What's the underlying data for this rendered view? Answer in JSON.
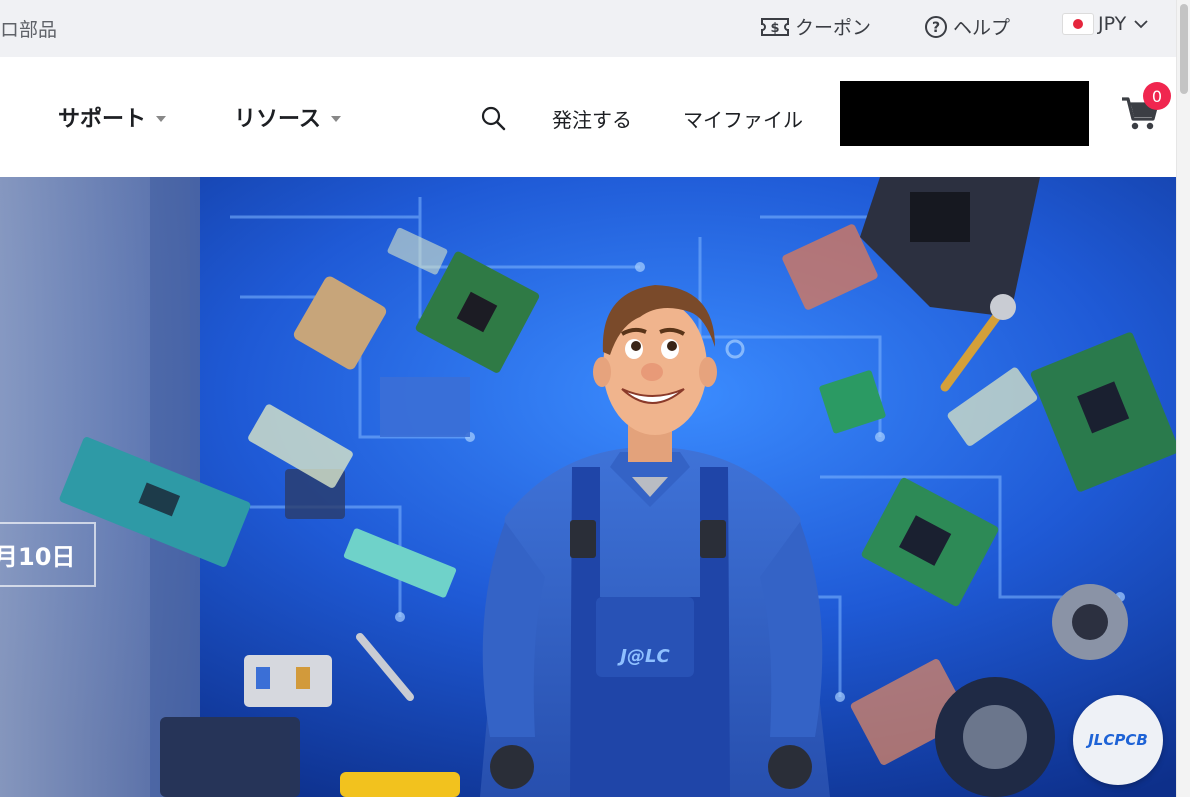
{
  "topbar": {
    "left_text": "ロ部品",
    "coupon_label": "クーポン",
    "help_label": "ヘルプ",
    "currency_label": "JPY"
  },
  "nav": {
    "support_label": "サポート",
    "resources_label": "リソース",
    "order_label": "発注する",
    "files_label": "マイファイル",
    "cart_count": "0"
  },
  "hero": {
    "date_text": "月10日",
    "overall_badge": "J@LC",
    "chat_bubble_label": "JLCPCB"
  },
  "colors": {
    "topbar_bg": "#f0f1f4",
    "badge_red": "#f0264f",
    "hero_blue": "#1f4fc4",
    "brand_blue": "#1e63d6"
  }
}
